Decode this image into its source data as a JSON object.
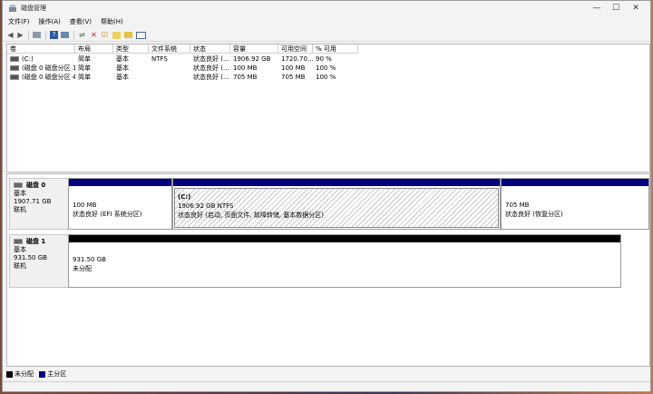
{
  "window": {
    "title": "磁盘管理",
    "controls": [
      "—",
      "☐",
      "✕"
    ]
  },
  "menu": [
    "文件(F)",
    "操作(A)",
    "查看(V)",
    "帮助(H)"
  ],
  "toolbar": [
    "back-icon",
    "forward-icon",
    "list-icon",
    "help-icon",
    "properties-icon",
    "connect-icon",
    "delete-icon",
    "check-icon",
    "new-icon",
    "folder-icon",
    "view-icon"
  ],
  "volumes": {
    "headers": [
      "卷",
      "布局",
      "类型",
      "文件系统",
      "状态",
      "容量",
      "可用空间",
      "% 可用"
    ],
    "rows": [
      [
        "(C:)",
        "简单",
        "基本",
        "NTFS",
        "状态良好 (...",
        "1906.92 GB",
        "1720.70...",
        "90 %"
      ],
      [
        "(磁盘 0 磁盘分区 1)",
        "简单",
        "基本",
        "",
        "状态良好 (...",
        "100 MB",
        "100 MB",
        "100 %"
      ],
      [
        "(磁盘 0 磁盘分区 4)",
        "简单",
        "基本",
        "",
        "状态良好 (...",
        "705 MB",
        "705 MB",
        "100 %"
      ]
    ]
  },
  "disks": [
    {
      "name": "磁盘 0",
      "type": "基本",
      "size": "1907.71 GB",
      "status": "联机",
      "partitions": [
        {
          "title": "",
          "size": "100 MB",
          "status": "状态良好 (EFI 系统分区)"
        },
        {
          "title": "(C:)",
          "size": "1906.92 GB NTFS",
          "status": "状态良好 (启动, 页面文件, 故障转储, 基本数据分区)"
        },
        {
          "title": "",
          "size": "705 MB",
          "status": "状态良好 (恢复分区)"
        }
      ]
    },
    {
      "name": "磁盘 1",
      "type": "基本",
      "size": "931.50 GB",
      "status": "联机",
      "partitions": [
        {
          "title": "",
          "size": "931.50 GB",
          "status": "未分配"
        }
      ]
    }
  ],
  "legend": [
    {
      "label": "未分配",
      "color": "#000000"
    },
    {
      "label": "主分区",
      "color": "#00007f"
    }
  ],
  "colors": {
    "primary": "#00007f",
    "unallocated": "#000000"
  }
}
